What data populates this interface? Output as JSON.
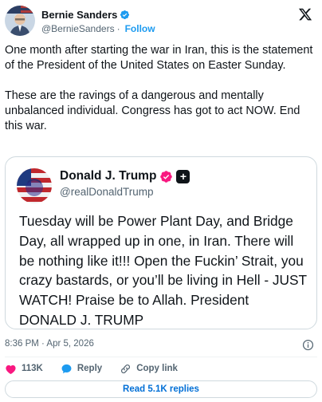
{
  "author": {
    "display_name": "Bernie Sanders",
    "handle": "@BernieSanders",
    "separator": "·",
    "follow_label": "Follow"
  },
  "tweet": {
    "paragraphs": [
      "One month after starting the war in Iran, this is the statement of the President of the United States on Easter Sunday.",
      "These are the ravings of a dangerous and mentally unbalanced individual. Congress has got to act NOW. End this war."
    ]
  },
  "quoted": {
    "display_name": "Donald J. Trump",
    "handle": "@realDonaldTrump",
    "plus_glyph": "+",
    "text": "Tuesday will be Power Plant Day, and Bridge Day, all wrapped up in one, in Iran. There will be nothing like it!!! Open the Fuckin’ Strait, you crazy bastards, or you’ll be living in Hell - JUST WATCH! Praise be to Allah. President DONALD J. TRUMP"
  },
  "meta": {
    "timestamp": "8:36 PM · Apr 5, 2026"
  },
  "actions": {
    "likes": "113K",
    "reply_label": "Reply",
    "copy_link_label": "Copy link"
  },
  "read_replies_label": "Read 5.1K replies",
  "colors": {
    "accent": "#1d9bf0",
    "like_red": "#f91880",
    "link_blue": "#006fd6",
    "gold_verified": "#e2b719",
    "text_primary": "#0f1419",
    "text_secondary": "#536471",
    "border": "#cfd9de"
  },
  "icons": {
    "verified": "verified-badge-icon",
    "x_logo": "x-logo-icon",
    "info": "info-icon",
    "like": "heart-icon",
    "reply": "speech-bubble-icon",
    "copy_link": "link-icon"
  }
}
